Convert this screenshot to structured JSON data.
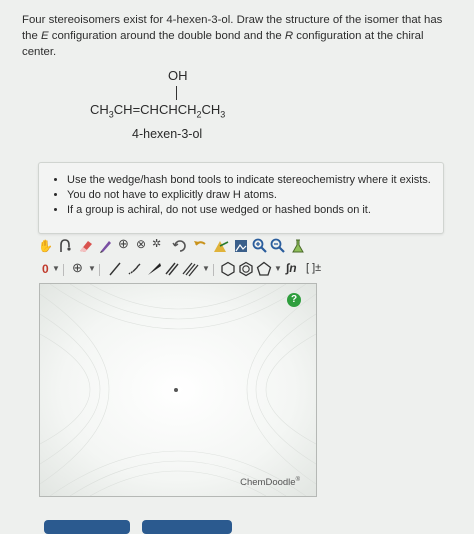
{
  "question": {
    "line1": "Four stereoisomers exist for 4-hexen-3-ol. Draw the structure of the isomer that has",
    "line2_pre": "the ",
    "line2_e": "E",
    "line2_mid": " configuration around the double bond and the ",
    "line2_r": "R",
    "line2_post": " configuration at the chiral",
    "line3": "center."
  },
  "molecule": {
    "oh": "OH",
    "formula_parts": [
      "CH",
      "3",
      "CH=CHCHCH",
      "2",
      "CH",
      "3"
    ],
    "name": "4-hexen-3-ol"
  },
  "hints": [
    "Use the wedge/hash bond tools to indicate stereochemistry where it exists.",
    "You do not have to explicitly draw H atoms.",
    "If a group is achiral, do not use wedged or hashed bonds on it."
  ],
  "toolbar": {
    "charge_label": "0",
    "plus_label": "⊕",
    "templates_label": "∫n",
    "brackets_label": "[ ]±"
  },
  "canvas": {
    "help_label": "?",
    "brand": "ChemDoodle",
    "brand_mark": "®"
  },
  "colors": {
    "accent": "#2b5a8f",
    "help_green": "#2f9e3e"
  }
}
